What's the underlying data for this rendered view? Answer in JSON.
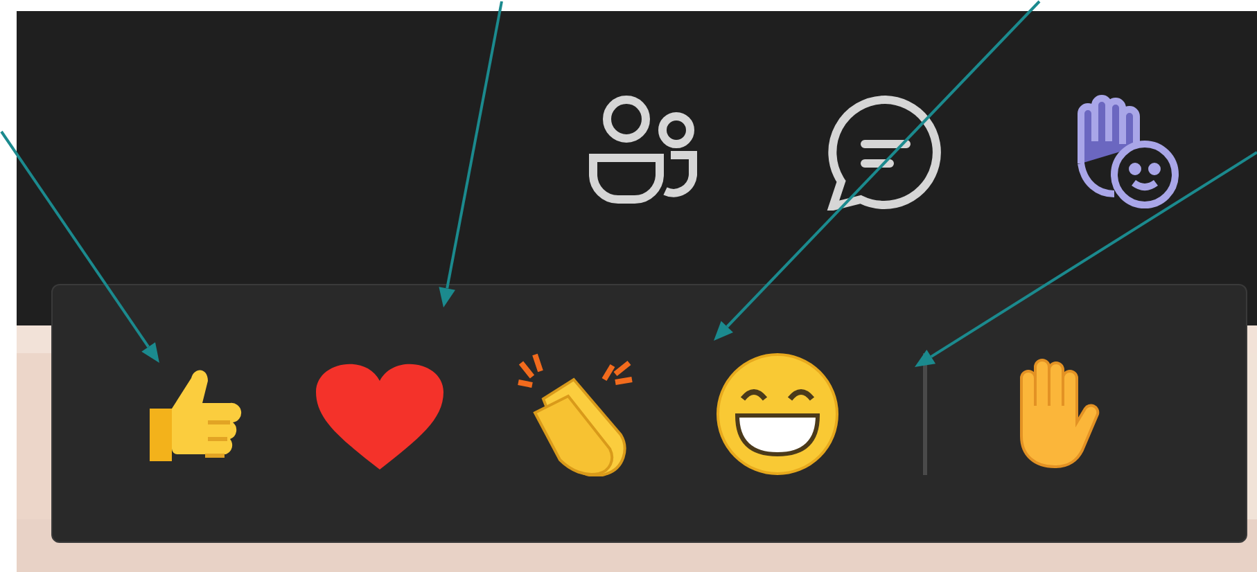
{
  "toolbar": [
    {
      "kind": "people"
    },
    {
      "kind": "chat"
    },
    {
      "kind": "react"
    }
  ],
  "reactions": [
    {
      "kind": "like"
    },
    {
      "kind": "heart"
    },
    {
      "kind": "clap"
    },
    {
      "kind": "laugh"
    },
    {
      "kind": "divider"
    },
    {
      "kind": "hand"
    }
  ],
  "arrows": [
    {
      "kind": "pointer"
    },
    {
      "kind": "pointer"
    },
    {
      "kind": "pointer"
    },
    {
      "kind": "pointer"
    }
  ]
}
